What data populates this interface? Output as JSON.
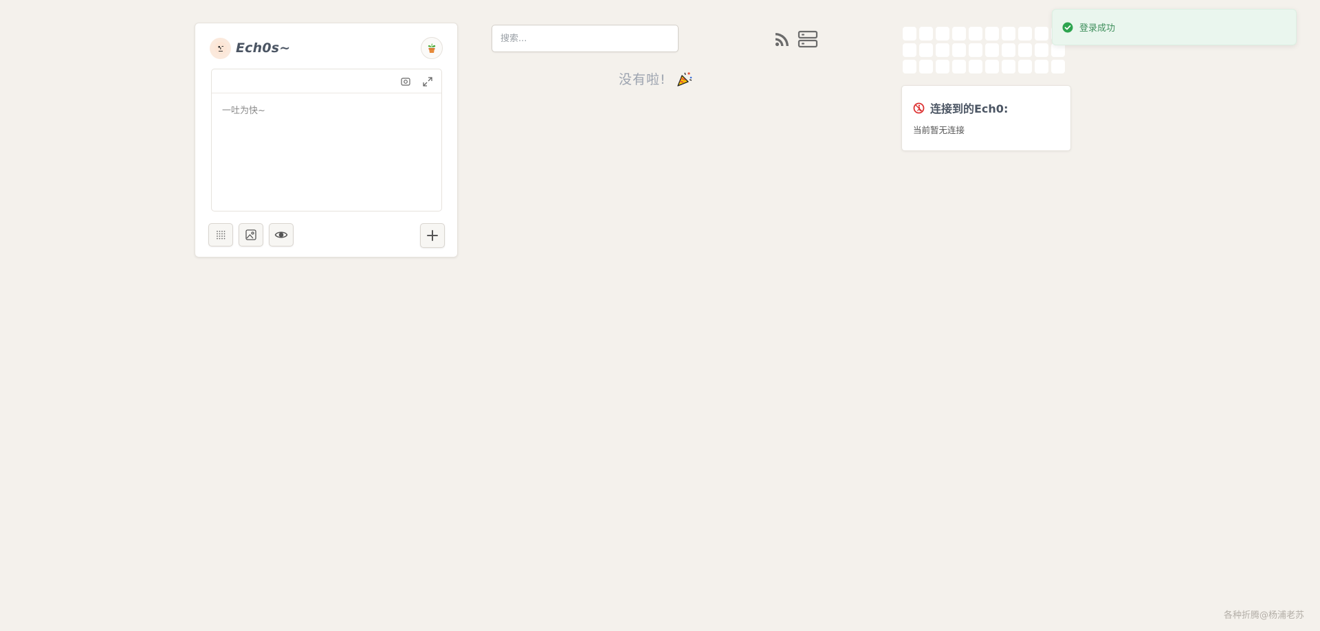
{
  "editor": {
    "brand": "Ech0s~",
    "placeholder": "一吐为快~",
    "icons": {
      "avatar": "face-avatar-icon",
      "plant": "potted-plant-icon",
      "live_preview": "live-preview-icon",
      "fullscreen": "expand-icon",
      "grid": "dotted-grid-icon",
      "image": "image-icon",
      "preview": "eye-icon",
      "add": "plus-icon"
    }
  },
  "search": {
    "placeholder": "搜索..."
  },
  "feed": {
    "empty_text": "没有啦!"
  },
  "heatmap": {
    "rows": 3,
    "cols": 10
  },
  "connect": {
    "title": "连接到的Ech0:",
    "empty": "当前暂无连接"
  },
  "toast": {
    "message": "登录成功",
    "color": "#3f8f5c"
  },
  "footer": {
    "text": "各种折腾@杨浦老苏"
  },
  "colors": {
    "background": "#f4f1ec",
    "card": "#ffffff",
    "accent_green": "#2ea44f",
    "accent_red": "#d33"
  }
}
